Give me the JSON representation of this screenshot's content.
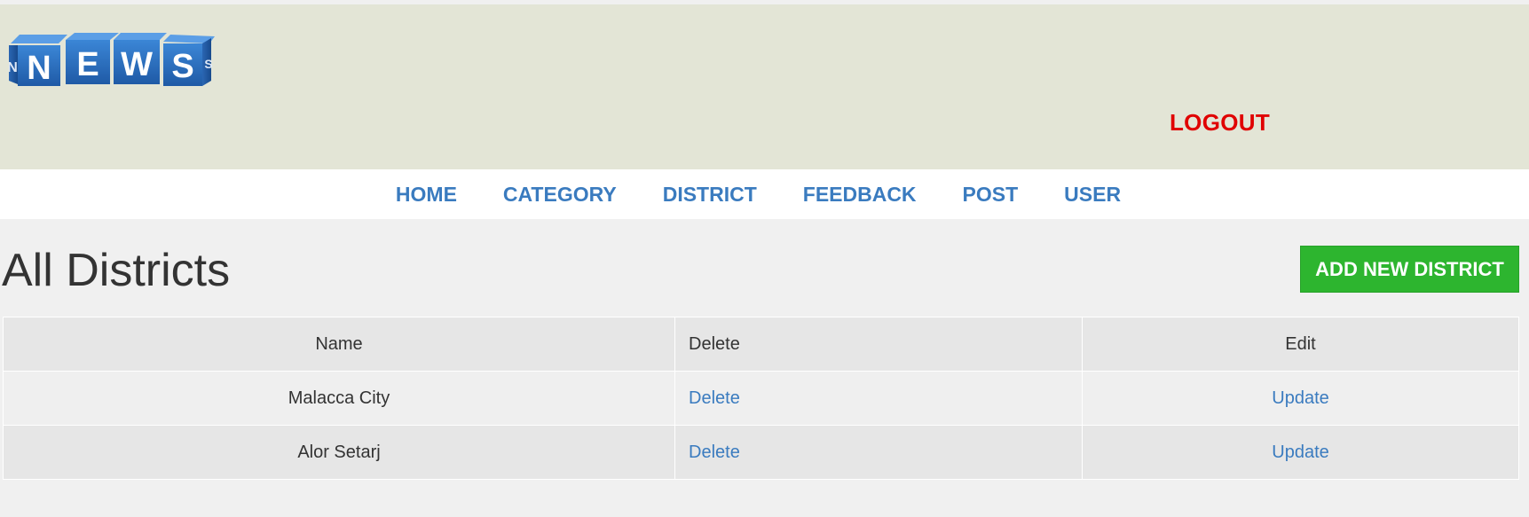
{
  "header": {
    "logo_letters": [
      "N",
      "E",
      "W",
      "S"
    ],
    "logout_label": "LOGOUT",
    "colors": {
      "background": "#e3e5d6",
      "logout": "#e00000",
      "logo_blue": "#2e6fc0"
    }
  },
  "nav": {
    "items": [
      {
        "label": "HOME"
      },
      {
        "label": "CATEGORY"
      },
      {
        "label": "DISTRICT"
      },
      {
        "label": "FEEDBACK"
      },
      {
        "label": "POST"
      },
      {
        "label": "USER"
      }
    ],
    "color": "#3a7bbf"
  },
  "main": {
    "title": "All Districts",
    "add_button_label": "ADD NEW DISTRICT",
    "add_button_color": "#2db52f",
    "table": {
      "headers": [
        "Name",
        "Delete",
        "Edit"
      ],
      "rows": [
        {
          "name": "Malacca City",
          "delete": "Delete",
          "edit": "Update"
        },
        {
          "name": "Alor Setarj",
          "delete": "Delete",
          "edit": "Update"
        }
      ]
    }
  }
}
